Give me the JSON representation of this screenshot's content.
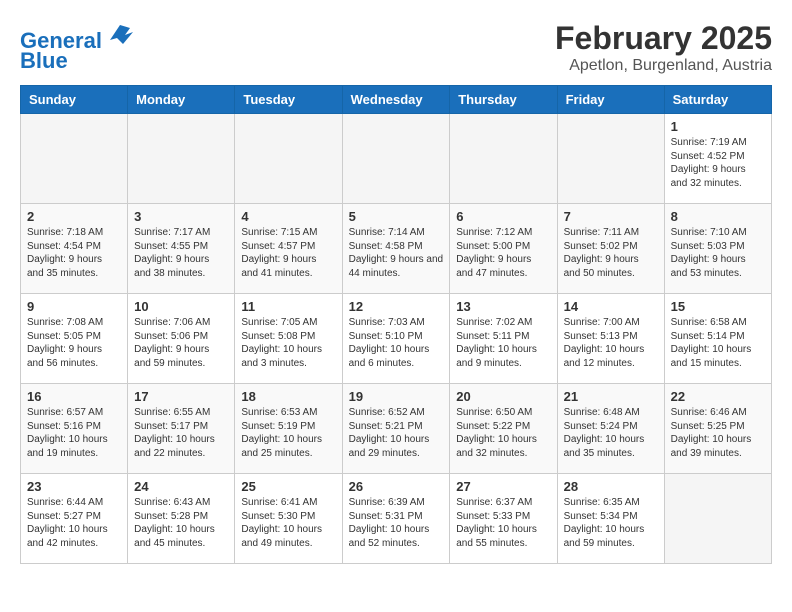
{
  "header": {
    "logo_line1": "General",
    "logo_line2": "Blue",
    "title": "February 2025",
    "subtitle": "Apetlon, Burgenland, Austria"
  },
  "days_of_week": [
    "Sunday",
    "Monday",
    "Tuesday",
    "Wednesday",
    "Thursday",
    "Friday",
    "Saturday"
  ],
  "weeks": [
    [
      {
        "day": "",
        "info": ""
      },
      {
        "day": "",
        "info": ""
      },
      {
        "day": "",
        "info": ""
      },
      {
        "day": "",
        "info": ""
      },
      {
        "day": "",
        "info": ""
      },
      {
        "day": "",
        "info": ""
      },
      {
        "day": "1",
        "info": "Sunrise: 7:19 AM\nSunset: 4:52 PM\nDaylight: 9 hours and 32 minutes."
      }
    ],
    [
      {
        "day": "2",
        "info": "Sunrise: 7:18 AM\nSunset: 4:54 PM\nDaylight: 9 hours and 35 minutes."
      },
      {
        "day": "3",
        "info": "Sunrise: 7:17 AM\nSunset: 4:55 PM\nDaylight: 9 hours and 38 minutes."
      },
      {
        "day": "4",
        "info": "Sunrise: 7:15 AM\nSunset: 4:57 PM\nDaylight: 9 hours and 41 minutes."
      },
      {
        "day": "5",
        "info": "Sunrise: 7:14 AM\nSunset: 4:58 PM\nDaylight: 9 hours and 44 minutes."
      },
      {
        "day": "6",
        "info": "Sunrise: 7:12 AM\nSunset: 5:00 PM\nDaylight: 9 hours and 47 minutes."
      },
      {
        "day": "7",
        "info": "Sunrise: 7:11 AM\nSunset: 5:02 PM\nDaylight: 9 hours and 50 minutes."
      },
      {
        "day": "8",
        "info": "Sunrise: 7:10 AM\nSunset: 5:03 PM\nDaylight: 9 hours and 53 minutes."
      }
    ],
    [
      {
        "day": "9",
        "info": "Sunrise: 7:08 AM\nSunset: 5:05 PM\nDaylight: 9 hours and 56 minutes."
      },
      {
        "day": "10",
        "info": "Sunrise: 7:06 AM\nSunset: 5:06 PM\nDaylight: 9 hours and 59 minutes."
      },
      {
        "day": "11",
        "info": "Sunrise: 7:05 AM\nSunset: 5:08 PM\nDaylight: 10 hours and 3 minutes."
      },
      {
        "day": "12",
        "info": "Sunrise: 7:03 AM\nSunset: 5:10 PM\nDaylight: 10 hours and 6 minutes."
      },
      {
        "day": "13",
        "info": "Sunrise: 7:02 AM\nSunset: 5:11 PM\nDaylight: 10 hours and 9 minutes."
      },
      {
        "day": "14",
        "info": "Sunrise: 7:00 AM\nSunset: 5:13 PM\nDaylight: 10 hours and 12 minutes."
      },
      {
        "day": "15",
        "info": "Sunrise: 6:58 AM\nSunset: 5:14 PM\nDaylight: 10 hours and 15 minutes."
      }
    ],
    [
      {
        "day": "16",
        "info": "Sunrise: 6:57 AM\nSunset: 5:16 PM\nDaylight: 10 hours and 19 minutes."
      },
      {
        "day": "17",
        "info": "Sunrise: 6:55 AM\nSunset: 5:17 PM\nDaylight: 10 hours and 22 minutes."
      },
      {
        "day": "18",
        "info": "Sunrise: 6:53 AM\nSunset: 5:19 PM\nDaylight: 10 hours and 25 minutes."
      },
      {
        "day": "19",
        "info": "Sunrise: 6:52 AM\nSunset: 5:21 PM\nDaylight: 10 hours and 29 minutes."
      },
      {
        "day": "20",
        "info": "Sunrise: 6:50 AM\nSunset: 5:22 PM\nDaylight: 10 hours and 32 minutes."
      },
      {
        "day": "21",
        "info": "Sunrise: 6:48 AM\nSunset: 5:24 PM\nDaylight: 10 hours and 35 minutes."
      },
      {
        "day": "22",
        "info": "Sunrise: 6:46 AM\nSunset: 5:25 PM\nDaylight: 10 hours and 39 minutes."
      }
    ],
    [
      {
        "day": "23",
        "info": "Sunrise: 6:44 AM\nSunset: 5:27 PM\nDaylight: 10 hours and 42 minutes."
      },
      {
        "day": "24",
        "info": "Sunrise: 6:43 AM\nSunset: 5:28 PM\nDaylight: 10 hours and 45 minutes."
      },
      {
        "day": "25",
        "info": "Sunrise: 6:41 AM\nSunset: 5:30 PM\nDaylight: 10 hours and 49 minutes."
      },
      {
        "day": "26",
        "info": "Sunrise: 6:39 AM\nSunset: 5:31 PM\nDaylight: 10 hours and 52 minutes."
      },
      {
        "day": "27",
        "info": "Sunrise: 6:37 AM\nSunset: 5:33 PM\nDaylight: 10 hours and 55 minutes."
      },
      {
        "day": "28",
        "info": "Sunrise: 6:35 AM\nSunset: 5:34 PM\nDaylight: 10 hours and 59 minutes."
      },
      {
        "day": "",
        "info": ""
      }
    ]
  ]
}
